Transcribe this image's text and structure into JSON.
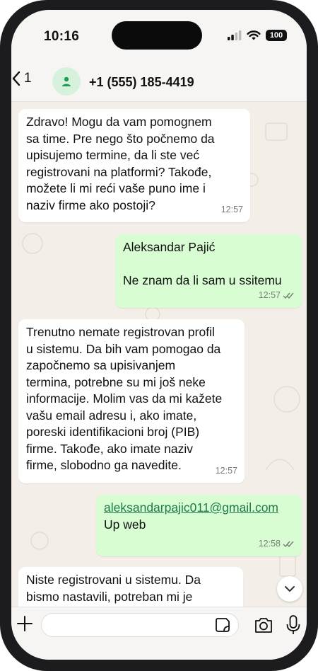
{
  "status": {
    "time": "10:16",
    "battery": "100"
  },
  "header": {
    "back_count": "1",
    "contact": "+1 (555) 185-4419"
  },
  "messages": [
    {
      "dir": "in",
      "text": "Zdravo! Mogu da vam pomognem\nsa time. Pre nego što počnemo da\nupisujemo termine, da li ste već\nregistrovani na platformi? Takođe,\nmožete li mi reći vaše puno ime i\nnaziv firme ako postoji?",
      "time": "12:57"
    },
    {
      "dir": "out",
      "text": "Aleksandar Pajić\n\nNe znam da li sam u ssitemu",
      "time": "12:57"
    },
    {
      "dir": "in",
      "text": "Trenutno nemate registrovan profil\nu sistemu. Da bih vam pomogao da\nzapočnemo sa upisivanjem\ntermina, potrebne su mi još neke\ninformacije. Molim vas da mi kažete\nvašu email adresu i, ako imate,\nporeski identifikacioni broj (PIB)\nfirme. Takođe, ako imate naziv\nfirme, slobodno ga navedite.",
      "time": "12:57"
    },
    {
      "dir": "out",
      "link": "aleksandarpajic011@gmail.com",
      "text": "\nUp web",
      "time": "12:58"
    },
    {
      "dir": "in",
      "text": "Niste registrovani u sistemu. Da\nbismo nastavili, potreban mi je\nporeski identifikacioni broj (PIB)",
      "time": ""
    }
  ],
  "input": {
    "placeholder": ""
  },
  "colors": {
    "accent": "#25d366",
    "outgoing_bubble": "#d8fdd2",
    "chat_bg": "#f3efe8",
    "read_ticks": "#53bdeb"
  }
}
